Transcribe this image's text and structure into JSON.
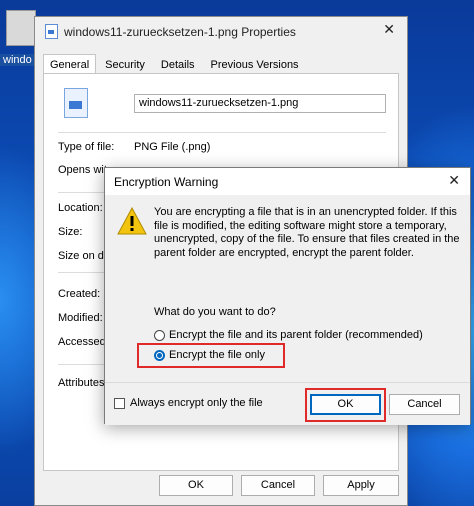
{
  "desktop": {
    "icon_label": "windo"
  },
  "properties": {
    "title": "windows11-zuruecksetzen-1.png Properties",
    "tabs": [
      "General",
      "Security",
      "Details",
      "Previous Versions"
    ],
    "filename": "windows11-zuruecksetzen-1.png",
    "fields": {
      "type_label": "Type of file:",
      "type_value": "PNG File (.png)",
      "opens_label": "Opens wit",
      "location_label": "Location:",
      "size_label": "Size:",
      "size_on_disk_label": "Size on di",
      "created_label": "Created:",
      "modified_label": "Modified:",
      "accessed_label": "Accessed",
      "attributes_label": "Attributes:"
    },
    "ok_label": "OK",
    "cancel_label": "Cancel",
    "apply_label": "Apply"
  },
  "dialog": {
    "title": "Encryption Warning",
    "message": "You are encrypting a file that is in an unencrypted folder. If this file is modified, the editing software might store a temporary, unencrypted, copy of the file. To ensure that files created in the parent folder are encrypted, encrypt the parent folder.",
    "question": "What do you want to do?",
    "option_folder": "Encrypt the file and its parent folder (recommended)",
    "option_file_only": "Encrypt the file only",
    "selected_option": "option_file_only",
    "always_label": "Always encrypt only the file",
    "ok_label": "OK",
    "cancel_label": "Cancel"
  },
  "colors": {
    "highlight": "#e02a2a",
    "accent": "#0067c0",
    "warning": "#f2c40f"
  }
}
